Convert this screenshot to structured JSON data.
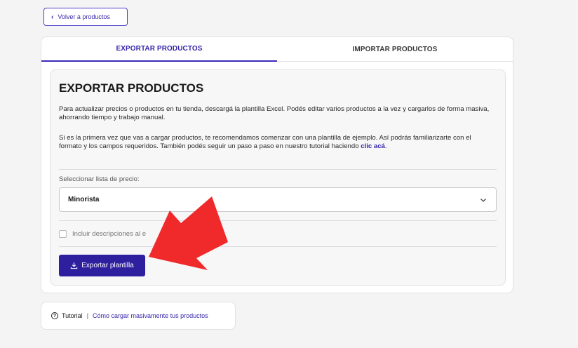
{
  "back_button": {
    "label": "Volver a productos",
    "icon": "chevron-left-icon"
  },
  "tabs": [
    {
      "label": "EXPORTAR PRODUCTOS",
      "active": true
    },
    {
      "label": "IMPORTAR PRODUCTOS",
      "active": false
    }
  ],
  "export": {
    "title": "EXPORTAR PRODUCTOS",
    "paragraph1": "Para actualizar precios o productos en tu tienda, descargá la plantilla Excel. Podés editar varios productos a la vez y cargarlos de forma masiva, ahorrando tiempo y trabajo manual.",
    "paragraph2": "Si es la primera vez que vas a cargar productos, te recomendamos comenzar con una plantilla de ejemplo. Así podrás familiarizarte con el formato y los campos requeridos. También podés seguir un paso a paso en nuestro tutorial haciendo ",
    "paragraph2_link": "clic acá",
    "paragraph2_end": ".",
    "select_label": "Seleccionar lista de precio:",
    "select_value": "Minorista",
    "checkbox_label": "Incluir descripciones al e",
    "checkbox_checked": false,
    "export_button": "Exportar plantilla"
  },
  "footer": {
    "label": "Tutorial",
    "separator": "|",
    "link": "Cómo cargar masivamente tus productos"
  },
  "colors": {
    "accent": "#2e1f9e",
    "link": "#3525a8",
    "annotation_arrow": "#f02a2a"
  }
}
